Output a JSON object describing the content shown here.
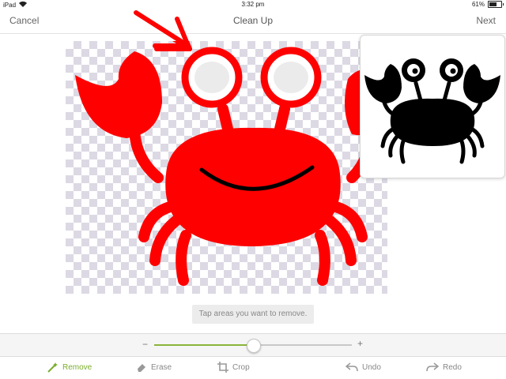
{
  "status_bar": {
    "device": "iPad",
    "time": "3:32 pm",
    "battery_text": "61%",
    "battery_level": 0.61,
    "icons": [
      "wifi-icon",
      "battery-icon"
    ]
  },
  "navbar": {
    "cancel_label": "Cancel",
    "title": "Clean Up",
    "next_label": "Next"
  },
  "hint": "Tap areas you want to remove.",
  "slider": {
    "minus_label": "−",
    "plus_label": "+",
    "value": 0.5
  },
  "toolbar": {
    "tools": [
      {
        "label": "Remove",
        "icon": "magic-wand-icon",
        "active": true
      },
      {
        "label": "Erase",
        "icon": "eraser-icon",
        "active": false
      },
      {
        "label": "Crop",
        "icon": "crop-icon",
        "active": false
      },
      {
        "label": "Undo",
        "icon": "undo-icon",
        "active": false
      },
      {
        "label": "Redo",
        "icon": "redo-icon",
        "active": false
      }
    ]
  },
  "colors": {
    "accent": "#7cae2d",
    "crab_red": "#ff0000",
    "preview_black": "#000000",
    "checker": "#dcd9e4"
  }
}
